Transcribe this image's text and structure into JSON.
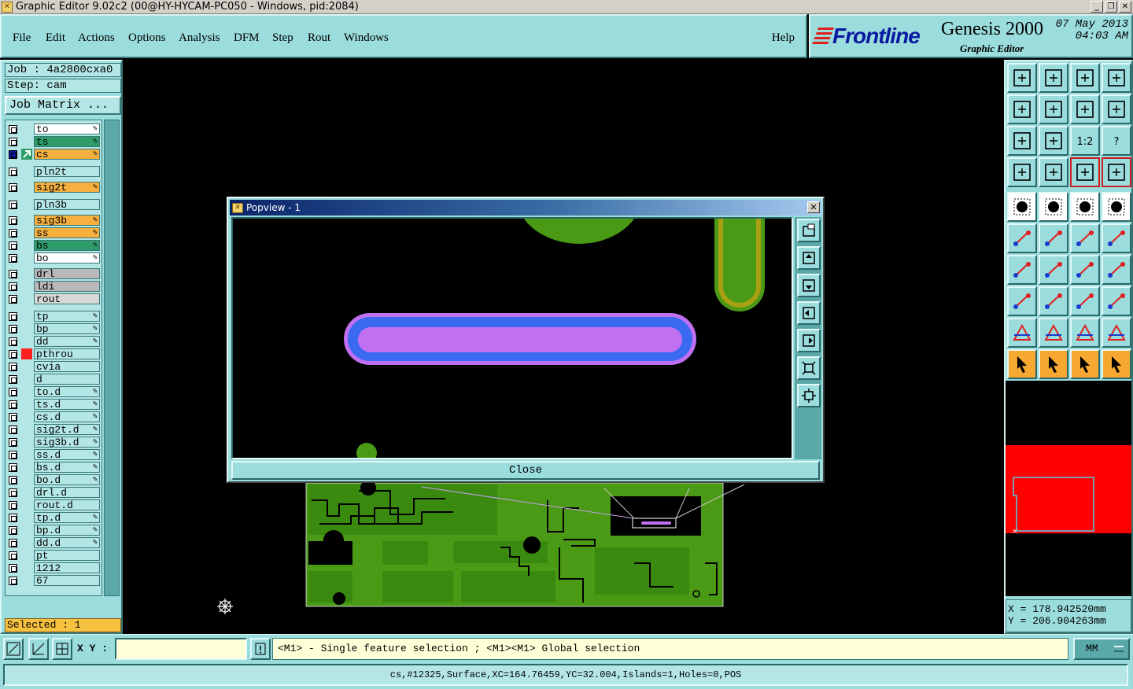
{
  "window": {
    "title": "Graphic Editor 9.02c2 (00@HY-HYCAM-PC050 - Windows, pid:2084)"
  },
  "menu": [
    "File",
    "Edit",
    "Actions",
    "Options",
    "Analysis",
    "DFM",
    "Step",
    "Rout",
    "Windows"
  ],
  "help_label": "Help",
  "brand": {
    "logo": "Frontline",
    "product": "Genesis 2000",
    "subtitle": "Graphic Editor",
    "date": "07 May 2013",
    "time": "04:03 AM"
  },
  "job": {
    "job_label": "Job : 4a2800cxa0",
    "step_label": "Step: cam",
    "matrix_button": "Job Matrix ..."
  },
  "layers": [
    {
      "name": "to",
      "color": "#ffffff",
      "pen": true
    },
    {
      "name": "ts",
      "color": "#2e9c6a",
      "pen": true
    },
    {
      "name": "cs",
      "color": "#f6b040",
      "pen": true,
      "active": true
    },
    {
      "name": "pln2t",
      "color": "#b4e6e6",
      "pen": false
    },
    {
      "name": "sig2t",
      "color": "#f6b040",
      "pen": true
    },
    {
      "name": "pln3b",
      "color": "#b4e6e6",
      "pen": false
    },
    {
      "name": "sig3b",
      "color": "#f6b040",
      "pen": true
    },
    {
      "name": "ss",
      "color": "#f6b040",
      "pen": true
    },
    {
      "name": "bs",
      "color": "#2e9c6a",
      "pen": true
    },
    {
      "name": "bo",
      "color": "#ffffff",
      "pen": true
    },
    {
      "name": "drl",
      "color": "#b8b8b8",
      "pen": false
    },
    {
      "name": "ldi",
      "color": "#b8b8b8",
      "pen": false
    },
    {
      "name": "rout",
      "color": "#d8d8d8",
      "pen": false
    },
    {
      "name": "tp",
      "color": "#b4e6e6",
      "pen": true
    },
    {
      "name": "bp",
      "color": "#b4e6e6",
      "pen": true
    },
    {
      "name": "dd",
      "color": "#b4e6e6",
      "pen": true
    },
    {
      "name": "pthrou",
      "color": "#b4e6e6",
      "pen": false,
      "red_mark": true
    },
    {
      "name": "cvia",
      "color": "#b4e6e6",
      "pen": false
    },
    {
      "name": "d",
      "color": "#b4e6e6",
      "pen": false
    },
    {
      "name": "to.d",
      "color": "#b4e6e6",
      "pen": true
    },
    {
      "name": "ts.d",
      "color": "#b4e6e6",
      "pen": true
    },
    {
      "name": "cs.d",
      "color": "#b4e6e6",
      "pen": true
    },
    {
      "name": "sig2t.d",
      "color": "#b4e6e6",
      "pen": true
    },
    {
      "name": "sig3b.d",
      "color": "#b4e6e6",
      "pen": true
    },
    {
      "name": "ss.d",
      "color": "#b4e6e6",
      "pen": true
    },
    {
      "name": "bs.d",
      "color": "#b4e6e6",
      "pen": true
    },
    {
      "name": "bo.d",
      "color": "#b4e6e6",
      "pen": true
    },
    {
      "name": "drl.d",
      "color": "#b4e6e6",
      "pen": false
    },
    {
      "name": "rout.d",
      "color": "#b4e6e6",
      "pen": false
    },
    {
      "name": "tp.d",
      "color": "#b4e6e6",
      "pen": true
    },
    {
      "name": "bp.d",
      "color": "#b4e6e6",
      "pen": true
    },
    {
      "name": "dd.d",
      "color": "#b4e6e6",
      "pen": true
    },
    {
      "name": "pt",
      "color": "#b4e6e6",
      "pen": false
    },
    {
      "name": "1212",
      "color": "#b4e6e6",
      "pen": false
    },
    {
      "name": "67",
      "color": "#b4e6e6",
      "pen": false
    }
  ],
  "selected_label": "Selected : 1",
  "coords": {
    "x_label": "X = 178.942520mm",
    "y_label": "Y = 206.904263mm"
  },
  "bottom": {
    "xy_label": "X Y :",
    "xy_value": "",
    "hint": "<M1> - Single feature selection ; <M1><M1> Global selection",
    "units": "MM"
  },
  "status": "cs,#12325,Surface,XC=164.76459,YC=32.004,Islands=1,Holes=0,POS",
  "popview": {
    "title": "Popview - 1",
    "close_label": "Close"
  },
  "colors": {
    "panel": "#9bdcdc",
    "board_green": "#4a9a16",
    "feature_purple": "#c070f0",
    "feature_blue": "#3a6af0",
    "overview_red": "#ff0000"
  }
}
